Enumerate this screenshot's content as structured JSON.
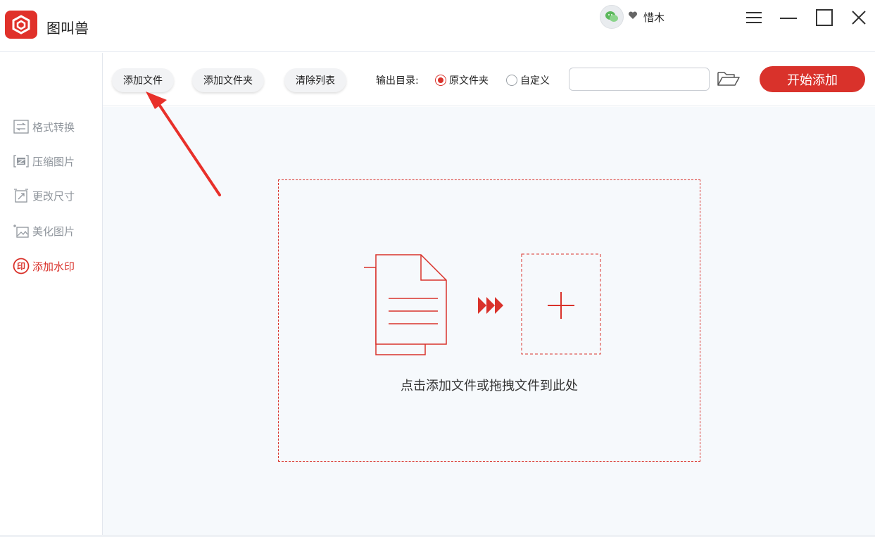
{
  "app": {
    "title": "图叫兽",
    "logo": "app-logo-icon"
  },
  "user": {
    "avatar": "wechat-avatar-icon",
    "vip_icon": "heart-icon",
    "name": "惜木"
  },
  "window_controls": [
    "menu-icon",
    "minimize-icon",
    "maximize-icon",
    "close-icon"
  ],
  "sidebar": {
    "items": [
      {
        "label": "格式转换",
        "icon": "convert-icon",
        "active": false
      },
      {
        "label": "压缩图片",
        "icon": "compress-icon",
        "active": false
      },
      {
        "label": "更改尺寸",
        "icon": "resize-icon",
        "active": false
      },
      {
        "label": "美化图片",
        "icon": "beautify-icon",
        "active": false
      },
      {
        "label": "添加水印",
        "icon": "watermark-icon",
        "active": true
      }
    ]
  },
  "toolbar": {
    "add_file": "添加文件",
    "add_folder": "添加文件夹",
    "clear_list": "清除列表",
    "output_label": "输出目录:",
    "radio_original": "原文件夹",
    "radio_custom": "自定义",
    "output_path": "",
    "start": "开始添加"
  },
  "dropzone": {
    "hint": "点击添加文件或拖拽文件到此处"
  },
  "colors": {
    "accent": "#d9322b",
    "main_bg": "#f6f9fc",
    "sidebar_text": "#8f959c"
  }
}
